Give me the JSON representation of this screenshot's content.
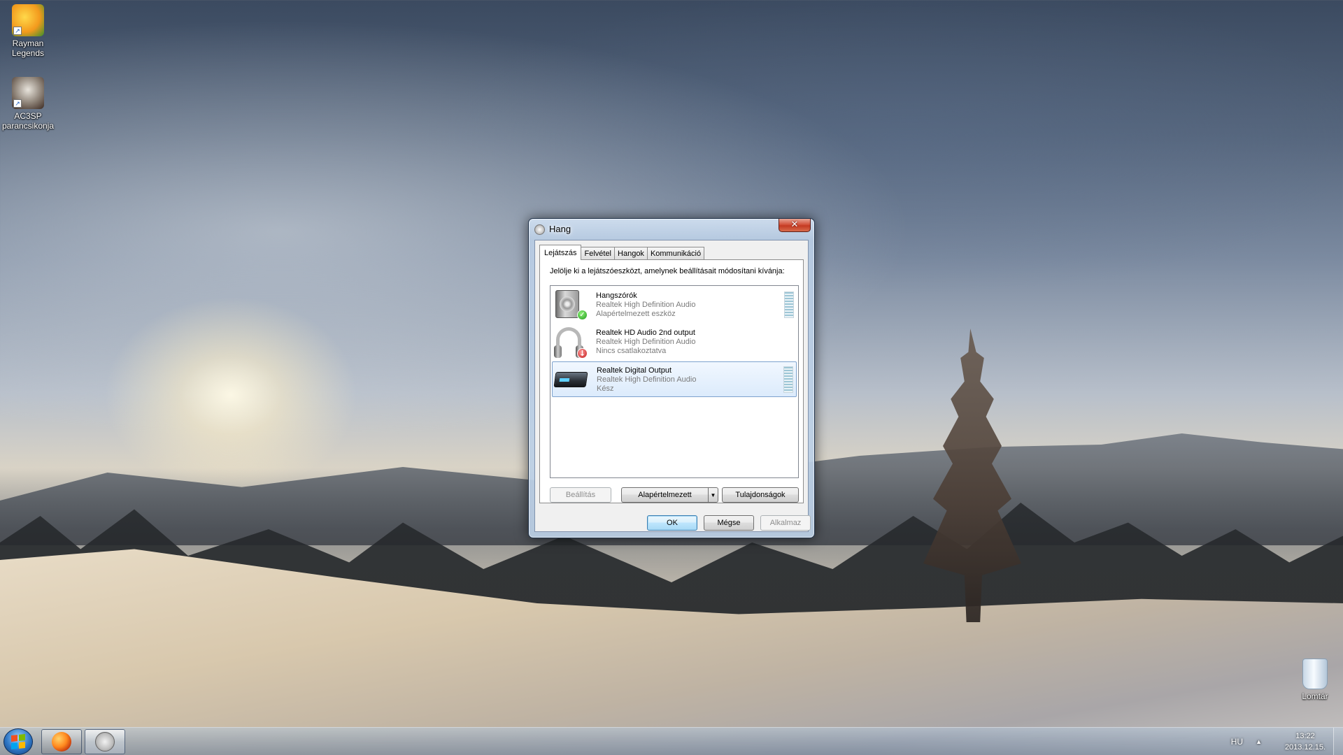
{
  "desktop": {
    "icons": [
      {
        "label_line1": "Rayman",
        "label_line2": "Legends",
        "icon": "rayman-legends-icon"
      },
      {
        "label_line1": "AC3SP",
        "label_line2": "parancsikonja",
        "icon": "ac3sp-icon"
      },
      {
        "label_line1": "Lomtár",
        "label_line2": "",
        "icon": "recycle-bin-icon"
      }
    ]
  },
  "taskbar": {
    "buttons": [
      {
        "name": "start-button",
        "icon": "windows-logo-icon"
      },
      {
        "name": "firefox",
        "icon": "firefox-icon"
      },
      {
        "name": "sound",
        "icon": "speaker-icon"
      }
    ],
    "tray": {
      "language": "HU",
      "expand_arrow": "▲",
      "time": "13:22",
      "date": "2013.12.15."
    }
  },
  "window": {
    "title": "Hang",
    "close_glyph": "✕",
    "tabs": [
      {
        "label": "Lejátszás",
        "active": true
      },
      {
        "label": "Felvétel",
        "active": false
      },
      {
        "label": "Hangok",
        "active": false
      },
      {
        "label": "Kommunikáció",
        "active": false
      }
    ],
    "instruction": "Jelölje ki a lejátszóeszközt, amelynek beállításait módosítani kívánja:",
    "devices": [
      {
        "name": "Hangszórók",
        "driver": "Realtek High Definition Audio",
        "status": "Alapértelmezett eszköz",
        "icon": "speaker-device-icon",
        "badge": "default-check-icon",
        "badge_glyph": "✓",
        "selected": false
      },
      {
        "name": "Realtek HD Audio 2nd output",
        "driver": "Realtek High Definition Audio",
        "status": "Nincs csatlakoztatva",
        "icon": "headphones-device-icon",
        "badge": "unplugged-icon",
        "badge_glyph": "↓",
        "selected": false
      },
      {
        "name": "Realtek Digital Output",
        "driver": "Realtek High Definition Audio",
        "status": "Kész",
        "icon": "digital-output-device-icon",
        "selected": true
      }
    ],
    "buttons": {
      "configure": "Beállítás",
      "set_default": "Alapértelmezett",
      "dropdown_glyph": "▼",
      "properties": "Tulajdonságok",
      "ok": "OK",
      "cancel": "Mégse",
      "apply": "Alkalmaz"
    }
  },
  "colors": {
    "selection_border": "#7da2ce",
    "close_button": "#c43b22",
    "default_button_border": "#3c7fb1"
  }
}
